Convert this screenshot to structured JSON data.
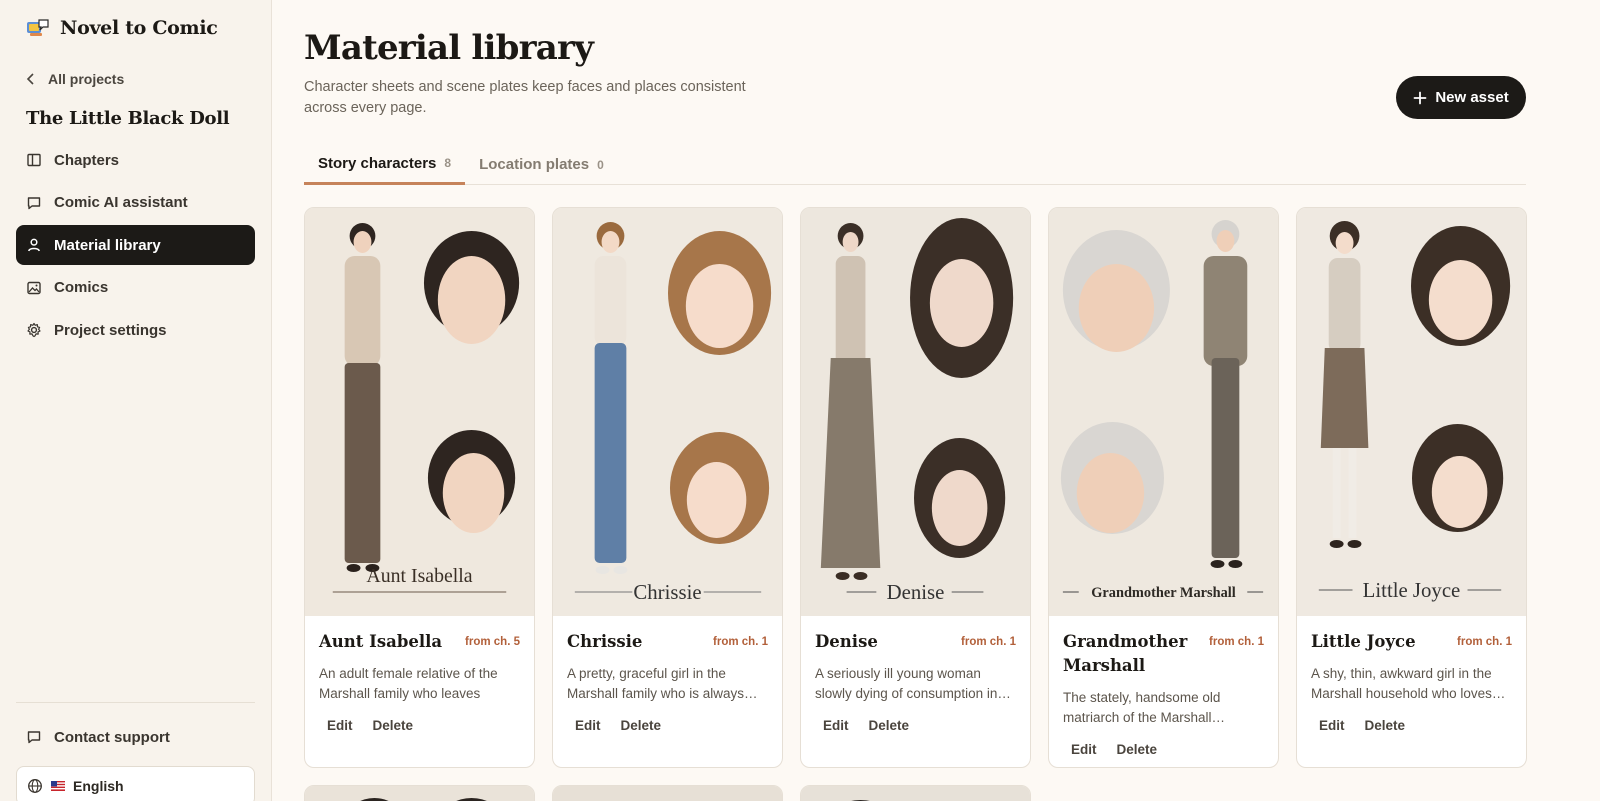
{
  "brand": {
    "name": "Novel to Comic",
    "logo": "comic-book-logo"
  },
  "sidebar": {
    "back_label": "All projects",
    "project_title": "The Little Black Doll",
    "items": [
      {
        "label": "Chapters",
        "icon": "book-icon",
        "active": false
      },
      {
        "label": "Comic AI assistant",
        "icon": "chat-icon",
        "active": false
      },
      {
        "label": "Material library",
        "icon": "person-icon",
        "active": true
      },
      {
        "label": "Comics",
        "icon": "image-icon",
        "active": false
      },
      {
        "label": "Project settings",
        "icon": "gear-icon",
        "active": false
      }
    ],
    "support_label": "Contact support",
    "language": "English"
  },
  "main": {
    "title": "Material library",
    "subtitle": "Character sheets and scene plates keep faces and places consistent across every page.",
    "new_asset_label": "New asset",
    "tabs": [
      {
        "label": "Story characters",
        "count": "8",
        "active": true
      },
      {
        "label": "Location plates",
        "count": "0",
        "active": false
      }
    ],
    "cards": [
      {
        "name": "Aunt Isabella",
        "chapter": "from ch. 5",
        "description": "An adult female relative of the Marshall family who leaves with…",
        "image_caption": "Aunt Isabella",
        "edit": "Edit",
        "delete": "Delete"
      },
      {
        "name": "Chrissie",
        "chapter": "from ch. 1",
        "description": "A pretty, graceful girl in the Marshall family who is always…",
        "image_caption": "Chrissie",
        "edit": "Edit",
        "delete": "Delete"
      },
      {
        "name": "Denise",
        "chapter": "from ch. 1",
        "description": "A seriously ill young woman slowly dying of consumption in…",
        "image_caption": "Denise",
        "edit": "Edit",
        "delete": "Delete"
      },
      {
        "name": "Grandmother Marshall",
        "chapter": "from ch. 1",
        "description": "The stately, handsome old matriarch of the Marshall…",
        "image_caption": "Grandmother Marshall",
        "edit": "Edit",
        "delete": "Delete"
      },
      {
        "name": "Little Joyce",
        "chapter": "from ch. 1",
        "description": "A shy, thin, awkward girl in the Marshall household who loves…",
        "image_caption": "Little Joyce",
        "edit": "Edit",
        "delete": "Delete"
      }
    ]
  },
  "colors": {
    "accent": "#c6835a",
    "chapter": "#b2603a",
    "dark": "#1c1a17",
    "background": "#fdf9f4"
  }
}
